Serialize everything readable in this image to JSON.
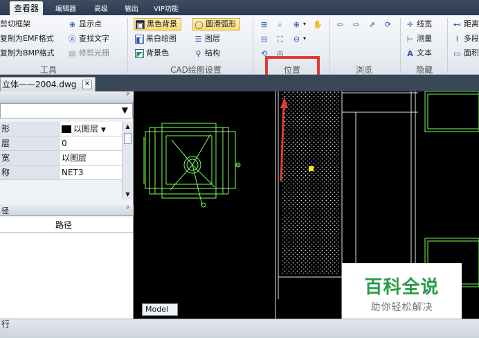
{
  "menu": {
    "tabs": [
      {
        "label": "查看器",
        "active": true
      },
      {
        "label": "编辑器"
      },
      {
        "label": "高级"
      },
      {
        "label": "输出"
      },
      {
        "label": "VIP功能"
      }
    ]
  },
  "ribbon": {
    "tools": {
      "items": [
        "剪切框架",
        "复制为EMF格式",
        "复制为BMP格式",
        "显示点",
        "查找文字",
        "修剪光栅"
      ],
      "label": "工具"
    },
    "cad": {
      "items": [
        "黑色背景",
        "圆滑弧形",
        "黑白绘图",
        "图层",
        "背景色",
        "结构"
      ],
      "label": "CAD绘图设置"
    },
    "position": {
      "label": "位置"
    },
    "browse": {
      "label": "浏览"
    },
    "hide": {
      "items": [
        "线宽",
        "测量",
        "文本"
      ],
      "label": "隐藏"
    },
    "measure": {
      "items": [
        "距离",
        "多段",
        "面积"
      ]
    }
  },
  "document": {
    "tab_title": "立体——2004.dwg"
  },
  "properties": {
    "rows": [
      {
        "key": "形",
        "value": "以图层"
      },
      {
        "key": "层",
        "value": "0"
      },
      {
        "key": "宽",
        "value": "以图层"
      },
      {
        "key": "称",
        "value": "NET3"
      }
    ]
  },
  "list_panel": {
    "header": "径",
    "column": "路径"
  },
  "canvas": {
    "model_tab": "Model"
  },
  "status": {
    "text": "行"
  },
  "watermark": {
    "title": "百科全说",
    "subtitle": "助你轻松解决"
  }
}
